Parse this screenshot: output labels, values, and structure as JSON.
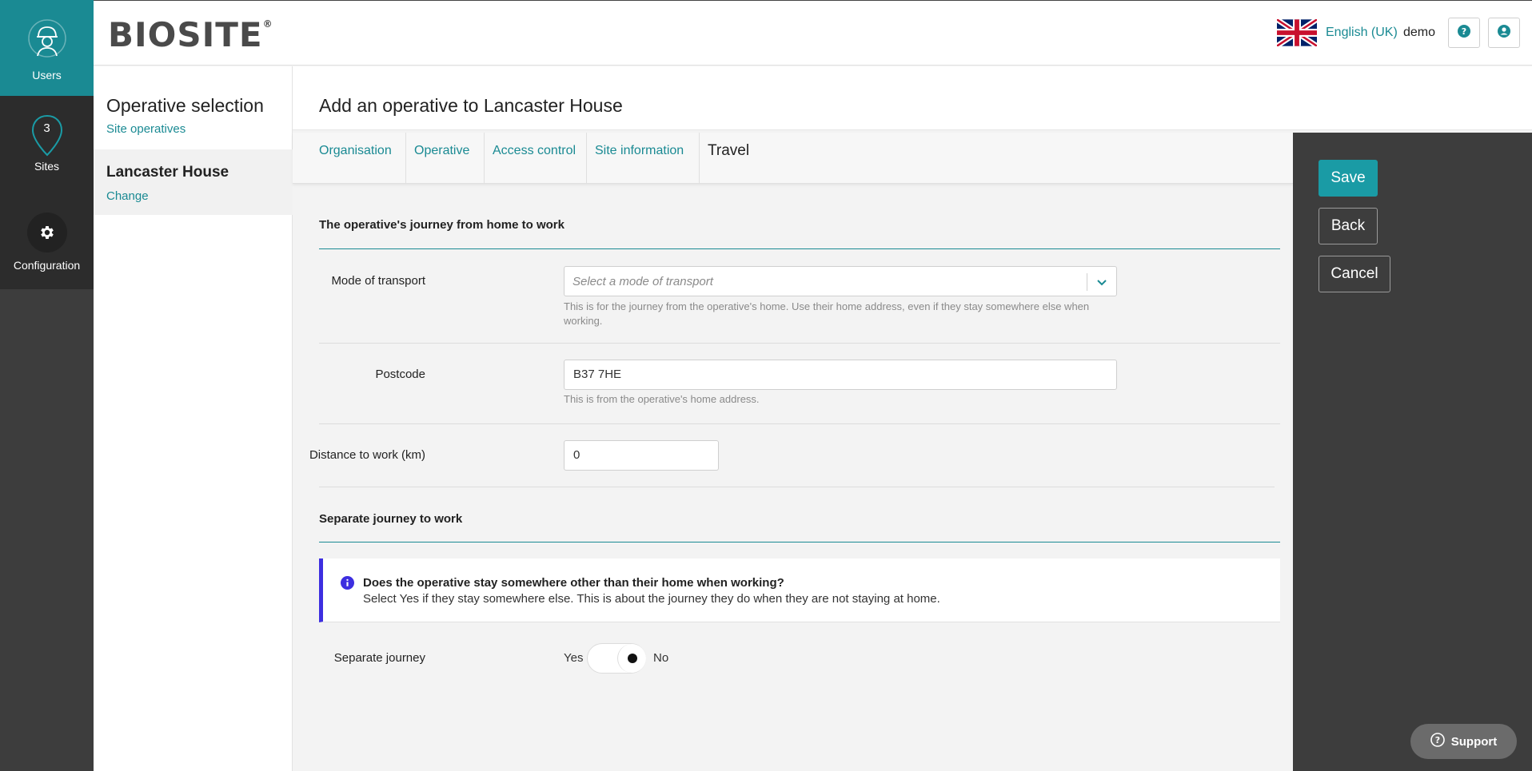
{
  "nav": {
    "items": [
      {
        "label": "Users",
        "icon": "worker-icon",
        "badge": ""
      },
      {
        "label": "Sites",
        "icon": "map-pin-icon",
        "badge": "3"
      },
      {
        "label": "Configuration",
        "icon": "gear-icon",
        "badge": ""
      }
    ]
  },
  "header": {
    "logo": "BIOSITE",
    "logo_mark": "®",
    "language": "English (UK)",
    "user": "demo"
  },
  "sidebar": {
    "selection_title": "Operative selection",
    "selection_link": "Site operatives",
    "site_name": "Lancaster House",
    "site_change": "Change"
  },
  "page": {
    "title": "Add an operative to Lancaster House"
  },
  "tabs": [
    {
      "label": "Organisation"
    },
    {
      "label": "Operative"
    },
    {
      "label": "Access control"
    },
    {
      "label": "Site information"
    },
    {
      "label": "Travel"
    }
  ],
  "form": {
    "section1_title": "The operative's journey from home to work",
    "mode_label": "Mode of transport",
    "mode_placeholder": "Select a mode of transport",
    "mode_hint": "This is for the journey from the operative's home. Use their home address, even if they stay somewhere else when working.",
    "postcode_label": "Postcode",
    "postcode_value": "B37 7HE",
    "postcode_hint": "This is from the operative's home address.",
    "distance_label": "Distance to work (km)",
    "distance_value": "0",
    "section2_title": "Separate journey to work",
    "info_title": "Does the operative stay somewhere other than their home when working?",
    "info_text": "Select Yes if they stay somewhere else. This is about the journey they do when they are not staying at home.",
    "separate_label": "Separate journey",
    "yes_label": "Yes",
    "no_label": "No",
    "separate_value": "No"
  },
  "actions": {
    "save": "Save",
    "back": "Back",
    "cancel": "Cancel"
  },
  "support": {
    "label": "Support"
  },
  "colors": {
    "accent": "#1a8a93",
    "info_border": "#3d2ee0",
    "rail": "#3d3d3d"
  }
}
